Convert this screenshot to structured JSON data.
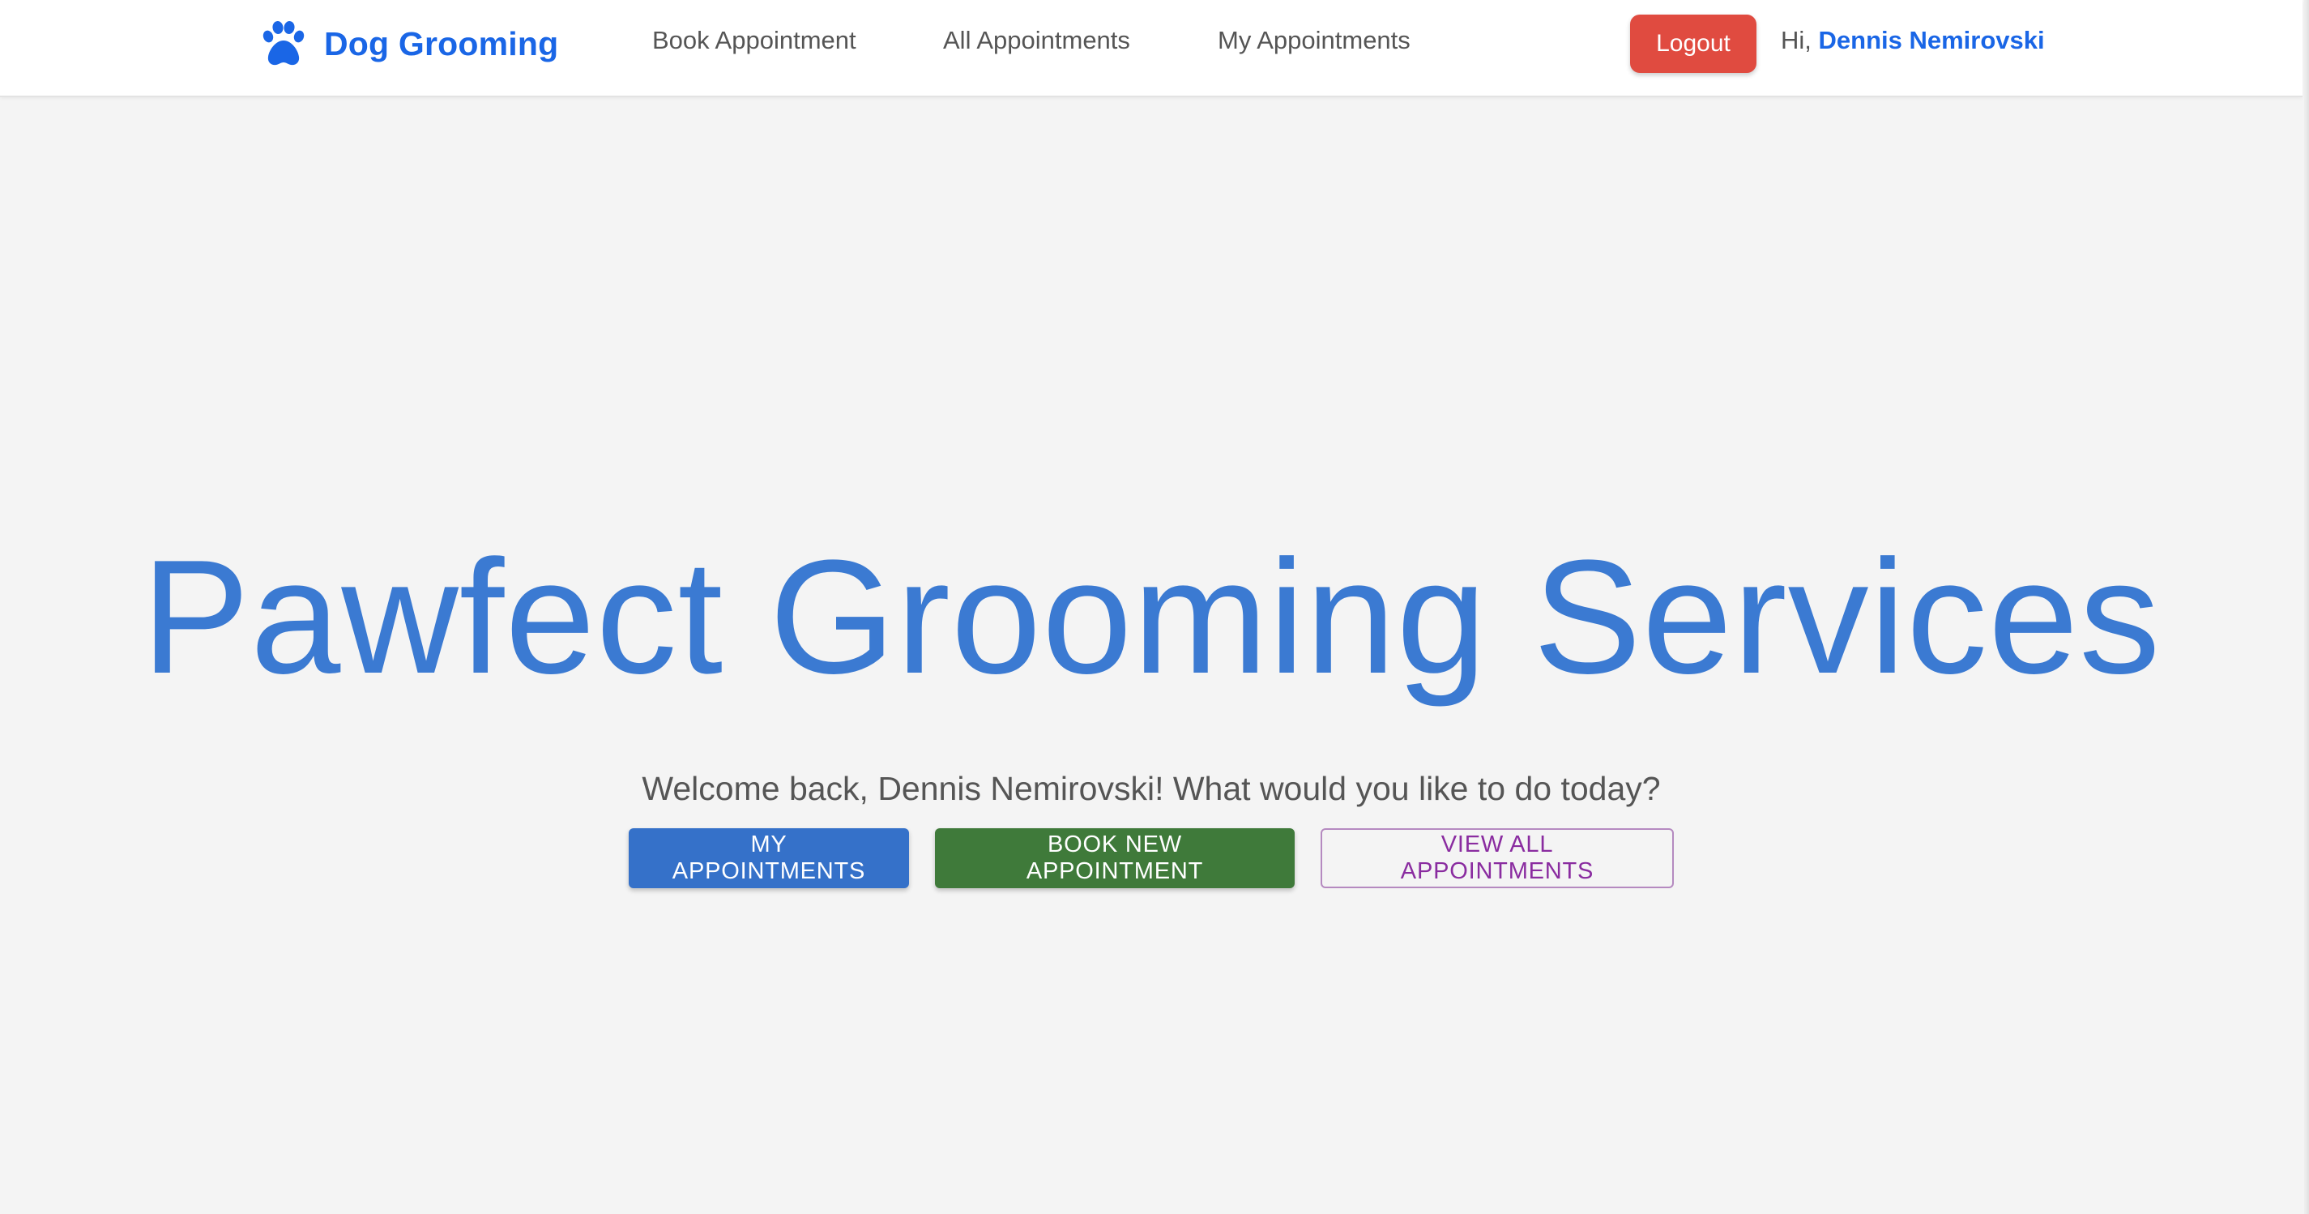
{
  "navbar": {
    "brand": {
      "icon": "paw-icon",
      "label": "Dog Grooming",
      "color": "#1a66e6"
    },
    "links": [
      {
        "label": "Book Appointment"
      },
      {
        "label": "All Appointments"
      },
      {
        "label": "My Appointments"
      }
    ],
    "logout_label": "Logout",
    "greeting_prefix": "Hi,",
    "user_name": "Dennis Nemirovski"
  },
  "hero": {
    "title": "Pawfect Grooming Services",
    "subtitle": "Welcome back, Dennis Nemirovski! What would you like to do today?",
    "buttons": [
      {
        "label": "MY APPOINTMENTS",
        "color": "#3571c9"
      },
      {
        "label": "BOOK NEW APPOINTMENT",
        "color": "#3f7a3a"
      },
      {
        "label": "VIEW ALL APPOINTMENTS",
        "color": "#8a2ca0"
      }
    ]
  },
  "colors": {
    "accent": "#1a66e6",
    "hero_title": "#3b7ad2",
    "logout": "#e04b40",
    "background": "#f4f4f4"
  }
}
